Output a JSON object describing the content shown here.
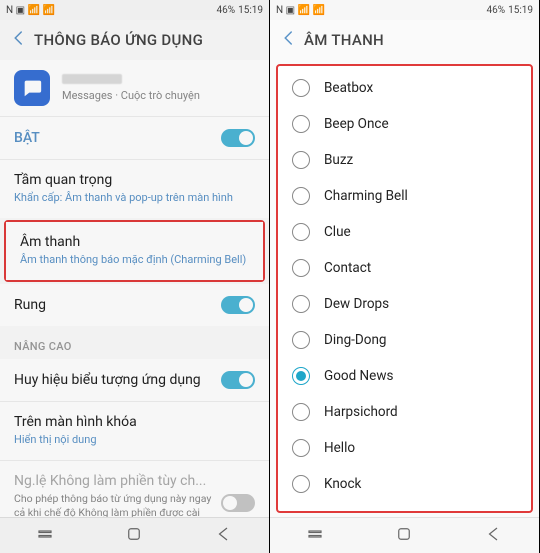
{
  "statusbar": {
    "time": "15:19",
    "battery": "46%",
    "signal_icons": "N ▣ 📶 📶"
  },
  "left": {
    "header_title": "THÔNG BÁO ỨNG DỤNG",
    "app_sub": "Messages · Cuộc trò chuyện",
    "on_label": "BẬT",
    "importance_title": "Tầm quan trọng",
    "importance_sub": "Khẩn cấp: Âm thanh và pop-up trên màn hình",
    "sound_title": "Âm thanh",
    "sound_sub": "Âm thanh thông báo mặc định (Charming Bell)",
    "vibrate_title": "Rung",
    "advanced_label": "NÂNG CAO",
    "badge_title": "Huy hiệu biểu tượng ứng dụng",
    "lockscreen_title": "Trên màn hình khóa",
    "lockscreen_sub": "Hiển thị nội dung",
    "dnd_title": "Ng.lệ Không làm phiền tùy ch...",
    "dnd_sub": "Cho phép thông báo từ ứng dụng này ngay cả khi chế độ Không làm phiền được cài đặt cho các ngoại lệ tùy chỉnh."
  },
  "right": {
    "header_title": "ÂM THANH",
    "sounds": [
      "Beatbox",
      "Beep Once",
      "Buzz",
      "Charming Bell",
      "Clue",
      "Contact",
      "Dew Drops",
      "Ding-Dong",
      "Good News",
      "Harpsichord",
      "Hello",
      "Knock"
    ],
    "selected": "Good News"
  }
}
